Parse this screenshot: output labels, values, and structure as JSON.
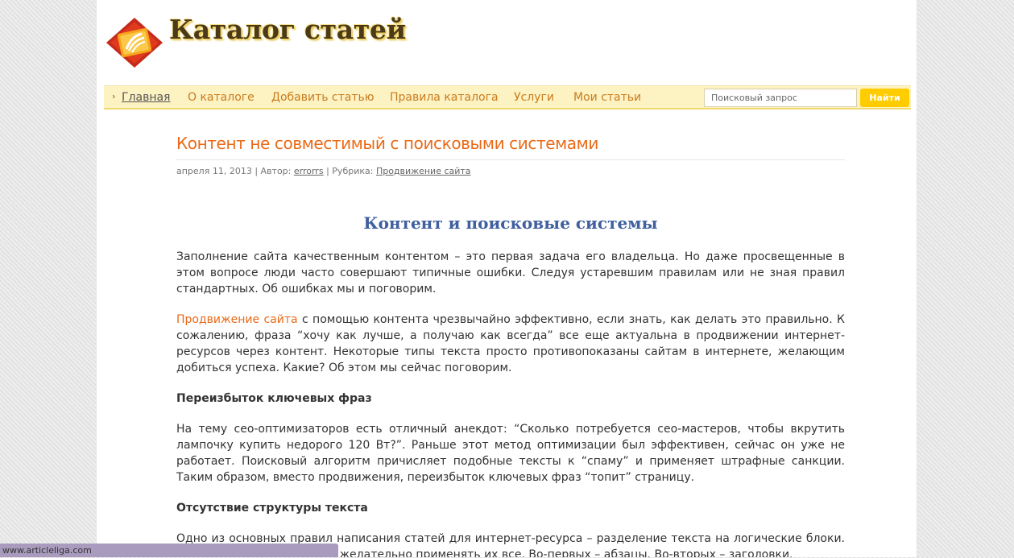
{
  "site": {
    "title": "Каталог статей"
  },
  "nav": {
    "items": [
      {
        "label": "Главная",
        "active": true
      },
      {
        "label": "О каталоге",
        "active": false
      },
      {
        "label": "Добавить статью",
        "active": false
      },
      {
        "label": "Правила каталога",
        "active": false
      },
      {
        "label": "Услуги",
        "active": false
      },
      {
        "label": "Мои статьи",
        "active": false
      }
    ],
    "bullet": "›"
  },
  "search": {
    "placeholder": "Поисковый запрос",
    "button_label": "Найти"
  },
  "article": {
    "title": "Контент не совместимый с поисковыми системами",
    "meta": {
      "date": "апреля 11, 2013",
      "sep": "|",
      "author_label": "Автор:",
      "author": "errorrs",
      "category_label": "Рубрика:",
      "category": "Продвижение сайта"
    },
    "section_title": "Контент и поисковые системы",
    "p1": "Заполнение сайта качественным контентом – это первая задача его владельца. Но даже просвещенные в этом вопросе люди часто совершают типичные ошибки. Следуя устаревшим правилам или не зная правил стандартных. Об ошибках мы и поговорим.",
    "p2_link": "Продвижение сайта",
    "p2_rest": " с помощью контента чрезвычайно эффективно, если знать, как делать это правильно. К сожалению, фраза “хочу как лучше, а получаю как всегда” все еще актуальна в продвижении интернет-ресурсов через контент. Некоторые типы текста просто противопоказаны сайтам в интернете, желающим добиться успеха. Какие? Об этом мы сейчас поговорим.",
    "h1": "Переизбыток ключевых фраз",
    "p3": "На тему сео-оптимизаторов есть отличный анекдот: “Сколько потребуется сео-мастеров, чтобы вкрутить лампочку купить недорого 120 Вт?”. Раньше этот метод оптимизации был эффективен, сейчас он уже не работает. Поисковый алгоритм причисляет подобные тексты к “спаму” и применяет штрафные санкции. Таким образом, вместо продвижения, переизбыток ключевых фраз “топит” страницу.",
    "h2": "Отсутствие структуры текста",
    "p4": "Одно из основных правил написания статей для интернет-ресурса – разделение текста на логические блоки. Таких блоков несколько, и желательно применять их все. Во-первых – абзацы. Во-вторых – заголовки."
  },
  "status_bar": {
    "url": "www.articleliga.com"
  },
  "colors": {
    "accent_orange": "#ea6a17",
    "nav_bg": "#fdf2c2",
    "button_yellow": "#ffcc00",
    "heading_blue": "#3f5f9e"
  }
}
